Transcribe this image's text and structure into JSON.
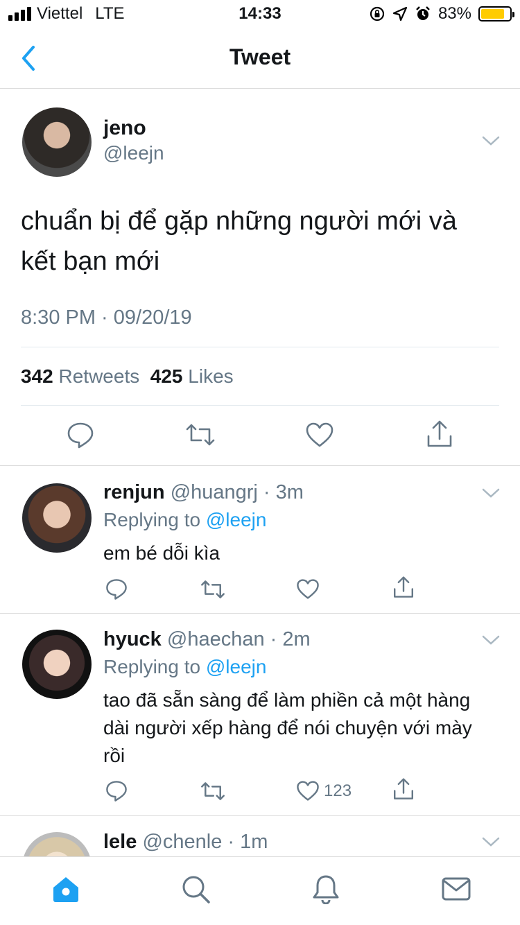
{
  "status_bar": {
    "carrier": "Viettel",
    "network": "LTE",
    "time": "14:33",
    "battery_percent": "83%",
    "battery_level": 0.83,
    "battery_color": "#ffcc00"
  },
  "nav": {
    "title": "Tweet",
    "back_icon": "chevron-left-icon"
  },
  "tweet": {
    "name": "jeno",
    "handle": "@leejn",
    "text": "chuẩn bị để gặp những người mới và kết bạn mới",
    "timestamp": "8:30 PM · 09/20/19",
    "retweets_count": "342",
    "retweets_label": "Retweets",
    "likes_count": "425",
    "likes_label": "Likes"
  },
  "replies": [
    {
      "name": "renjun",
      "handle_time": "@huangrj · 3m",
      "replying_label": "Replying to",
      "replying_handle": "@leejn",
      "text": "em bé dỗi kìa",
      "like_count": ""
    },
    {
      "name": "hyuck",
      "handle_time": "@haechan · 2m",
      "replying_label": "Replying to",
      "replying_handle": "@leejn",
      "text": "tao đã sẵn sàng để làm phiền cả một hàng dài người xếp hàng để nói chuyện với mày rồi",
      "like_count": "123"
    },
    {
      "name": "lele",
      "handle_time": "@chenle · 1m"
    }
  ],
  "tab_bar": {
    "items": [
      "home-icon",
      "search-icon",
      "notifications-icon",
      "messages-icon"
    ]
  },
  "colors": {
    "accent": "#1da1f2",
    "secondary_text": "#657786"
  }
}
